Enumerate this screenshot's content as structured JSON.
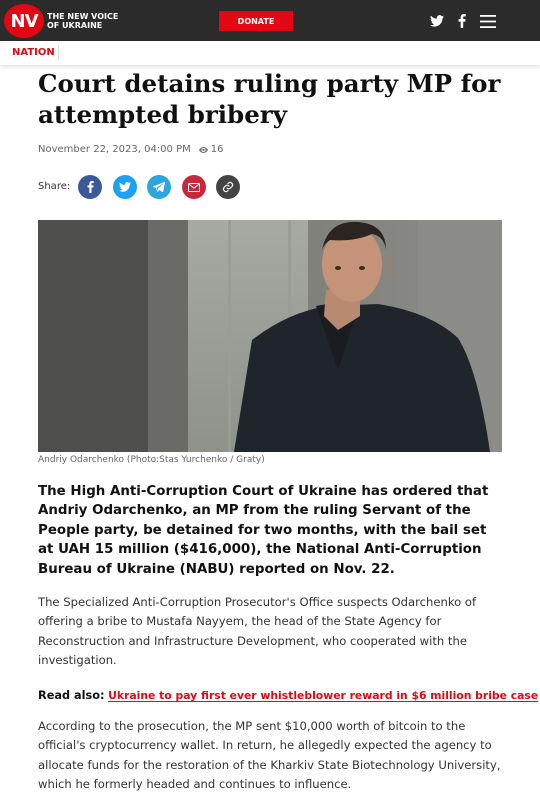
{
  "header": {
    "logo_mark": "NV",
    "logo_line1": "THE NEW VOICE",
    "logo_line2": "OF UKRAINE",
    "donate_label": "DONATE"
  },
  "nav": {
    "section": "NATION"
  },
  "article": {
    "title": "Court detains ruling party MP for attempted bribery",
    "date": "November 22, 2023, 04:00 PM",
    "views": "16",
    "share_label": "Share:",
    "photo_caption": "Andriy Odarchenko (Photo:Stas Yurchenko / Graty)",
    "lead": "The High Anti-Corruption Court of Ukraine has ordered that Andriy Odarchenko, an MP from the ruling Servant of the People party, be detained for two months, with the bail set at UAH 15 million ($416,000), the National Anti-Corruption Bureau of Ukraine (NABU) reported on Nov. 22.",
    "paragraph1": "The Specialized Anti-Corruption Prosecutor's Office suspects Odarchenko of offering a bribe to Mustafa Nayyem, the head of the State Agency for Reconstruction and Infrastructure Development, who cooperated with the investigation.",
    "read_also_label": "Read also:",
    "read_also_link": "Ukraine to pay first ever whistleblower reward in $6 million bribe case",
    "paragraph2": "According to the prosecution, the MP sent $10,000 worth of bitcoin to the official's cryptocurrency wallet. In return, he allegedly expected the agency to allocate funds for the restoration of the Kharkiv State Biotechnology University, which he formerly headed and continues to influence."
  },
  "share_icons": [
    "facebook-icon",
    "twitter-icon",
    "telegram-icon",
    "email-icon",
    "copy-link-icon"
  ],
  "colors": {
    "brand_red": "#e30613",
    "header_bg": "#2b2b2b",
    "facebook": "#3b5998",
    "twitter": "#1da1f2",
    "telegram": "#2ca5e0",
    "email": "#c8293a",
    "copy_link": "#444444"
  }
}
